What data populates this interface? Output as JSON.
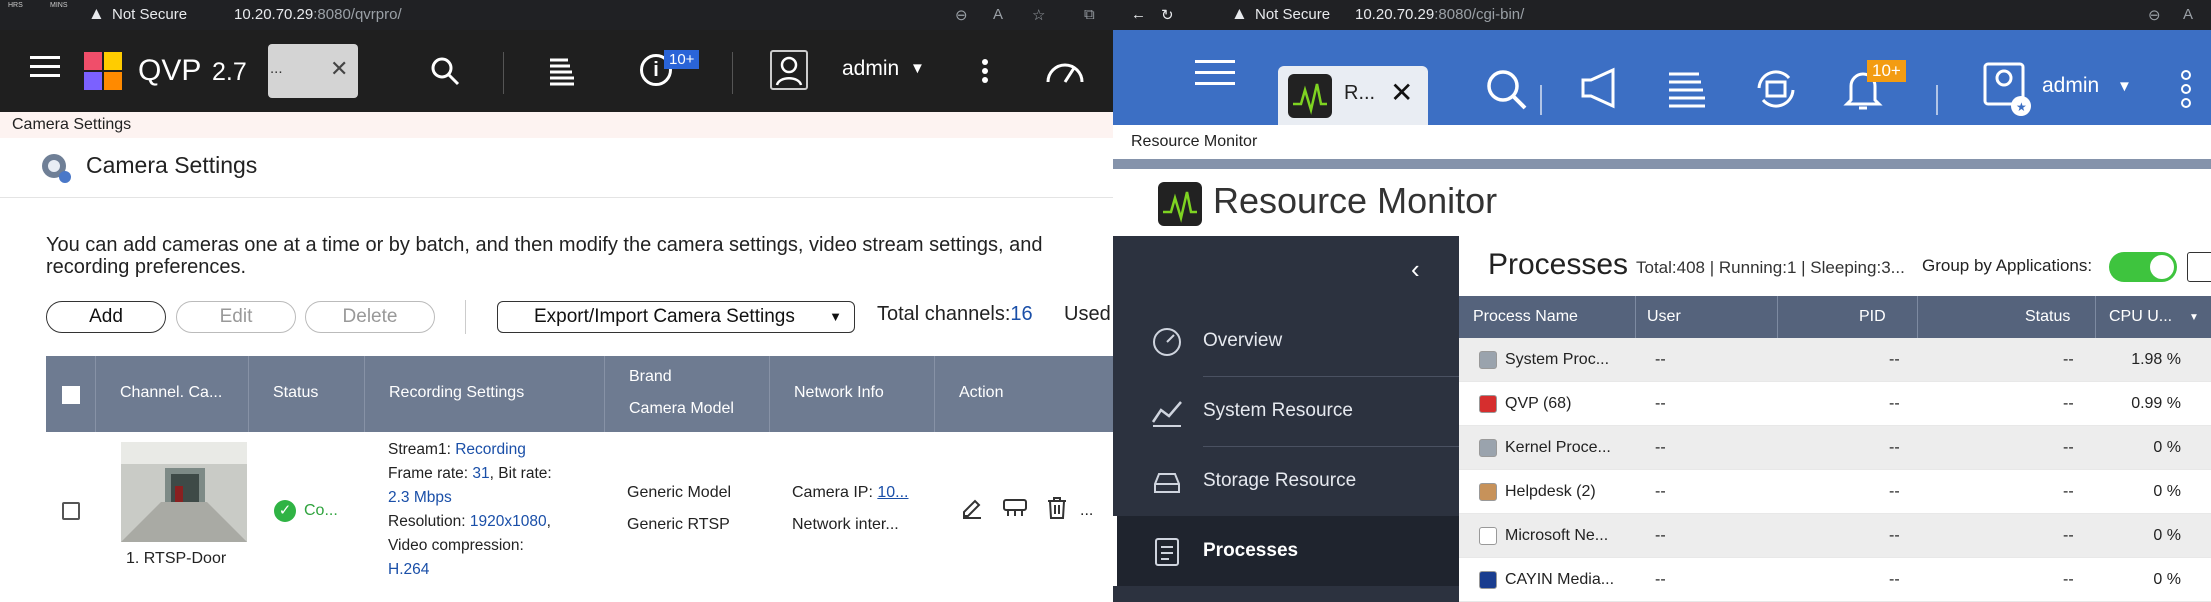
{
  "left_window": {
    "tabs": {
      "chip1": "HRS",
      "chip2": "MINS"
    },
    "address": {
      "security": "Not Secure",
      "host": "10.20.70.29",
      "path": ":8080/qvrpro/"
    },
    "header": {
      "app_name": "QVP",
      "version": "2.7",
      "search_chip_text": "...",
      "info_badge": "10+",
      "user": "admin"
    },
    "breadcrumb": "Camera Settings",
    "page_title": "Camera Settings",
    "description": "You can add cameras one at a time or by batch, and then modify the camera settings, video stream settings, and recording preferences.",
    "toolbar": {
      "add": "Add",
      "edit": "Edit",
      "delete": "Delete",
      "export": "Export/Import Camera Settings",
      "total_label": "Total channels:",
      "total_value": "16",
      "used": "Used"
    },
    "table": {
      "headers": {
        "channel": "Channel. Ca...",
        "status": "Status",
        "recording": "Recording Settings",
        "brand": "Brand",
        "model": "Camera Model",
        "network": "Network Info",
        "action": "Action"
      },
      "row": {
        "channel_name": "1. RTSP-Door",
        "status": "Co...",
        "stream_label": "Stream1: ",
        "stream_value": "Recording",
        "framerate_label": "Frame rate: ",
        "framerate_value": "31",
        "bitrate_label": ", Bit rate:",
        "bitrate_value": "2.3 Mbps",
        "resolution_label": "Resolution: ",
        "resolution_value": "1920x1080",
        "resolution_suffix": ",",
        "compression_label": "Video compression:",
        "compression_value": "H.264",
        "brand": "Generic Model",
        "model": "Generic RTSP",
        "ip_label": "Camera IP: ",
        "ip_value": "10...",
        "network_interface": "Network inter...",
        "more": "..."
      }
    }
  },
  "right_window": {
    "address": {
      "security": "Not Secure",
      "host": "10.20.70.29",
      "path": ":8080/cgi-bin/"
    },
    "header": {
      "tab_label": "R...",
      "badge": "10+",
      "user": "admin"
    },
    "breadcrumb": "Resource Monitor",
    "app_title": "Resource Monitor",
    "sidebar": [
      "Overview",
      "System Resource",
      "Storage Resource",
      "Processes"
    ],
    "processes": {
      "title": "Processes",
      "total_label": "Total:",
      "total": "408",
      "running_label": "Running:",
      "running": "1",
      "sleeping_label": "Sleeping:",
      "sleeping": "3...",
      "group_label": "Group by Applications:",
      "columns": [
        "Process Name",
        "User",
        "PID",
        "Status",
        "CPU U..."
      ],
      "rows": [
        {
          "name": "System Proc...",
          "user": "--",
          "pid": "--",
          "status": "--",
          "cpu": "1.98 %"
        },
        {
          "name": "QVP (68)",
          "user": "--",
          "pid": "--",
          "status": "--",
          "cpu": "0.99 %"
        },
        {
          "name": "Kernel Proce...",
          "user": "--",
          "pid": "--",
          "status": "--",
          "cpu": "0 %"
        },
        {
          "name": "Helpdesk (2)",
          "user": "--",
          "pid": "--",
          "status": "--",
          "cpu": "0 %"
        },
        {
          "name": "Microsoft Ne...",
          "user": "--",
          "pid": "--",
          "status": "--",
          "cpu": "0 %"
        },
        {
          "name": "CAYIN Media...",
          "user": "--",
          "pid": "--",
          "status": "--",
          "cpu": "0 %"
        }
      ]
    }
  },
  "colors": {
    "qvp_header": "#1f1f1f",
    "qts_header": "#3c6fc4",
    "sidebar": "#2c323f",
    "table_header": "#6e7b91",
    "link_blue": "#1a4fa8",
    "toggle_green": "#3ec43e"
  }
}
